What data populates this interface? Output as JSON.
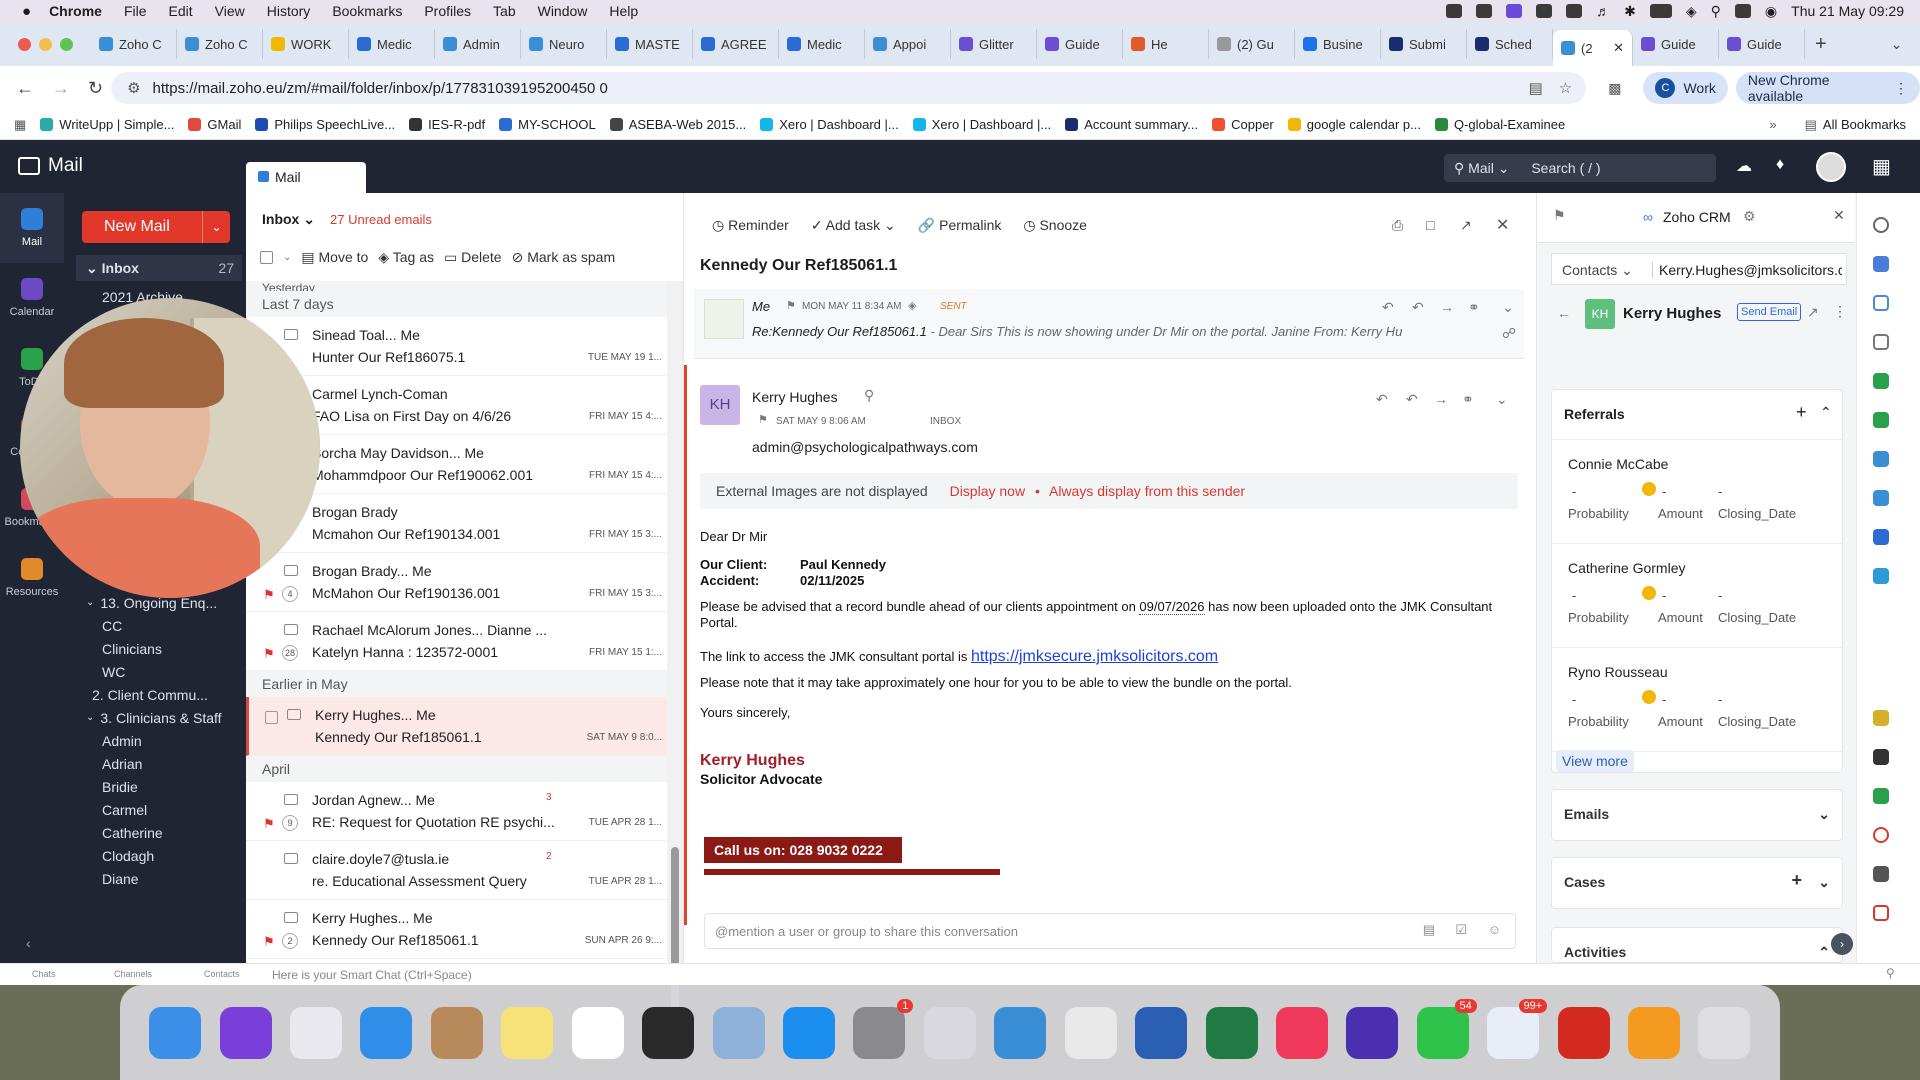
{
  "menubar": {
    "app": "Chrome",
    "items": [
      "File",
      "Edit",
      "View",
      "History",
      "Bookmarks",
      "Profiles",
      "Tab",
      "Window",
      "Help"
    ],
    "clock": "Thu 21 May  09:29"
  },
  "tabs": [
    {
      "label": "Zoho C",
      "color": "#3a8ed6"
    },
    {
      "label": "Zoho C",
      "color": "#3a8ed6"
    },
    {
      "label": "WORK",
      "color": "#f2b705"
    },
    {
      "label": "Medic",
      "color": "#2a6bd4"
    },
    {
      "label": "Admin",
      "color": "#3a8ed6"
    },
    {
      "label": "Neuro",
      "color": "#3a8ed6"
    },
    {
      "label": "MASTE",
      "color": "#2a6bd4"
    },
    {
      "label": "AGREE",
      "color": "#2a6bd4"
    },
    {
      "label": "Medic",
      "color": "#2a6bd4"
    },
    {
      "label": "Appoi",
      "color": "#3a8ed6"
    },
    {
      "label": "Glitter",
      "color": "#6b4fd3"
    },
    {
      "label": "Guide",
      "color": "#6b4fd3"
    },
    {
      "label": "He",
      "color": "#e05a2b"
    },
    {
      "label": "(2) Gu",
      "color": "#999"
    },
    {
      "label": "Busine",
      "color": "#1a73e8"
    },
    {
      "label": "Submi",
      "color": "#1a2b6e"
    },
    {
      "label": "Sched",
      "color": "#1a2b6e"
    },
    {
      "label": "(2",
      "color": "#3a8ed6",
      "active": true
    },
    {
      "label": "Guide",
      "color": "#6b4fd3"
    },
    {
      "label": "Guide",
      "color": "#6b4fd3"
    }
  ],
  "addr": {
    "url": "https://mail.zoho.eu/zm/#mail/folder/inbox/p/177831039195200450 0",
    "work": "Work",
    "update": "New Chrome available"
  },
  "bookmarks": [
    {
      "label": "WriteUpp | Simple...",
      "color": "#2aa9a9"
    },
    {
      "label": "GMail",
      "color": "#e04a3c"
    },
    {
      "label": "Philips SpeechLive...",
      "color": "#1b4db3"
    },
    {
      "label": "IES-R-pdf",
      "color": "#333"
    },
    {
      "label": "MY-SCHOOL",
      "color": "#2a6bd4"
    },
    {
      "label": "ASEBA-Web 2015...",
      "color": "#444"
    },
    {
      "label": "Xero | Dashboard |...",
      "color": "#13b5ea"
    },
    {
      "label": "Xero | Dashboard |...",
      "color": "#13b5ea"
    },
    {
      "label": "Account summary...",
      "color": "#1a2b6e"
    },
    {
      "label": "Copper",
      "color": "#f04f30"
    },
    {
      "label": "google calendar p...",
      "color": "#f2b705"
    },
    {
      "label": "Q-global-Examinee",
      "color": "#2a8a3a"
    }
  ],
  "all_bookmarks": "All Bookmarks",
  "zoho": {
    "app_title": "Mail",
    "mail_tab": "Mail",
    "search_scope": "Mail",
    "search_placeholder": "Search ( / )",
    "new_mail": "New Mail"
  },
  "leftnav": [
    {
      "label": "Mail",
      "color": "#2f7fd8"
    },
    {
      "label": "Calendar",
      "color": "#6a4bc4"
    },
    {
      "label": "ToDo",
      "color": "#2aa04a"
    },
    {
      "label": "Contacts",
      "color": "#d04a4a"
    },
    {
      "label": "Bookmarks",
      "color": "#d04a5c"
    },
    {
      "label": "Resources",
      "color": "#e08a2a"
    }
  ],
  "folders": {
    "inbox": "Inbox",
    "inbox_count": "27",
    "archive": "2021 Archive",
    "items": [
      "13. Ongoing Enq...",
      "CC",
      "Clinicians",
      "WC",
      "2. Client Commu...",
      "3. Clinicians & Staff",
      "Admin",
      "Adrian",
      "Bridie",
      "Carmel",
      "Catherine",
      "Clodagh",
      "Diane"
    ]
  },
  "list": {
    "title": "Inbox",
    "unread": "27 Unread emails",
    "actions": [
      "Move to",
      "Tag as",
      "Delete",
      "Mark as spam"
    ],
    "group_yesterday": "Yesterday",
    "group_week": "Last 7 days",
    "group_may": "Earlier in May",
    "group_april": "April",
    "rows": [
      {
        "sender": "Sinead Toal... Me",
        "subject": "Hunter Our Ref186075.1",
        "date": "TUE MAY 19 1..."
      },
      {
        "sender": "Carmel Lynch-Coman",
        "subject": "FAO Lisa on First Day on 4/6/26",
        "date": "FRI MAY 15 4:..."
      },
      {
        "sender": "Sorcha May Davidson... Me",
        "subject": "Mohammdpoor Our Ref190062.001",
        "date": "FRI MAY 15 4:..."
      },
      {
        "sender": "Brogan Brady",
        "subject": "Mcmahon Our Ref190134.001",
        "date": "FRI MAY 15 3:..."
      },
      {
        "sender": "Brogan Brady... Me",
        "subject": "McMahon Our Ref190136.001",
        "date": "FRI MAY 15 3:...",
        "count": "4",
        "flag": true
      },
      {
        "sender": "Rachael McAlorum Jones... Dianne ...",
        "subject": "Katelyn Hanna : 123572-0001",
        "date": "FRI MAY 15 1:...",
        "count": "28",
        "flag": true
      },
      {
        "sender": "Kerry Hughes... Me",
        "subject": "Kennedy Our Ref185061.1",
        "date": "SAT MAY 9 8:0..."
      },
      {
        "sender": "Jordan Agnew... Me",
        "subject": "RE: Request for Quotation RE psychi...",
        "date": "TUE APR 28 1...",
        "count": "9",
        "flag": true,
        "tag": "3"
      },
      {
        "sender": "claire.doyle7@tusla.ie",
        "subject": "re. Educational Assessment Query",
        "date": "TUE APR 28 1...",
        "tag": "2"
      },
      {
        "sender": "Kerry Hughes... Me",
        "subject": "Kennedy Our Ref185061.1",
        "date": "SUN APR 26 9:...",
        "count": "2",
        "flag": true
      }
    ]
  },
  "reading": {
    "toolbar": [
      "Reminder",
      "Add task",
      "Permalink",
      "Snooze"
    ],
    "subject": "Kennedy Our Ref185061.1",
    "thread1": {
      "from": "Me",
      "date": "MON MAY 11 8:34 AM",
      "status": "SENT",
      "preview_subject": "Re:Kennedy Our Ref185061.1",
      "preview": " - Dear Sirs This is now showing under Dr Mir on the portal. Janine From: Kerry Hughes <Kerry...."
    },
    "thread2": {
      "initials": "KH",
      "from": "Kerry Hughes",
      "date": "SAT MAY 9 8:06 AM",
      "folder": "INBOX",
      "to": "admin@psychologicalpathways.com"
    },
    "images_notice": "External Images are not displayed",
    "display_now": "Display now",
    "always_display": "Always display from this sender",
    "body": {
      "greeting": "Dear Dr Mir",
      "client_label": "Our Client:",
      "client": "Paul Kennedy",
      "accident_label": "Accident:",
      "accident": "02/11/2025",
      "p1a": "Please be advised that a record bundle ahead of our clients appointment on ",
      "p1date": "09/07/2026",
      "p1b": " has now been uploaded onto the JMK Consultant Portal.",
      "p2": "The link to access the JMK consultant portal is ",
      "link": "https://jmksecure.jmksolicitors.com",
      "p3": "Please note that it may take approximately one hour for you to be able to view the bundle on the portal.",
      "closing": "Yours sincerely,",
      "sig_name": "Kerry Hughes",
      "sig_title": "Solicitor Advocate",
      "call": "Call us on: 028 9032 0222"
    },
    "mention_placeholder": "@mention a user or group to share this conversation"
  },
  "crm": {
    "title": "Zoho CRM",
    "module": "Contacts",
    "email": "Kerry.Hughes@jmksolicitors.co",
    "contact_initials": "KH",
    "contact": "Kerry Hughes",
    "send_email": "Send Email",
    "referrals": "Referrals",
    "refs": [
      {
        "name": "Connie McCabe"
      },
      {
        "name": "Catherine Gormley"
      },
      {
        "name": "Ryno Rousseau"
      }
    ],
    "dash": "-",
    "amount_dash": "-",
    "lbl_prob": "Probability",
    "lbl_amount": "Amount",
    "lbl_close": "Closing_Date",
    "view_more": "View more",
    "emails": "Emails",
    "cases": "Cases",
    "activities": "Activities"
  },
  "footer": {
    "chats": "Chats",
    "channels": "Channels",
    "contacts": "Contacts",
    "smartchat": "Here is your Smart Chat (Ctrl+Space)"
  },
  "dock": [
    {
      "name": "finder",
      "color": "#3b8fe8"
    },
    {
      "name": "siri",
      "color": "#7a3fd8"
    },
    {
      "name": "launchpad",
      "color": "#e8e8ee"
    },
    {
      "name": "safari",
      "color": "#2f8fe8"
    },
    {
      "name": "contacts",
      "color": "#b8895a"
    },
    {
      "name": "notes",
      "color": "#f7e27a"
    },
    {
      "name": "freeform",
      "color": "#ffffff"
    },
    {
      "name": "app-dark",
      "color": "#2a2a2a"
    },
    {
      "name": "preview",
      "color": "#8fb0d8"
    },
    {
      "name": "app-store",
      "color": "#1b8ef0"
    },
    {
      "name": "system-settings",
      "color": "#8a8a8e",
      "badge": "1"
    },
    {
      "name": "iphone-mirroring",
      "color": "#d8d8de"
    },
    {
      "name": "zoho-workdrive",
      "color": "#3a8ed6"
    },
    {
      "name": "chrome",
      "color": "#e8e8e8"
    },
    {
      "name": "word",
      "color": "#2b5fb3"
    },
    {
      "name": "excel",
      "color": "#1f7a44"
    },
    {
      "name": "music",
      "color": "#f0395a"
    },
    {
      "name": "glitter",
      "color": "#4a2fb0"
    },
    {
      "name": "facetime",
      "color": "#2fc24a",
      "badge": "54"
    },
    {
      "name": "mail",
      "color": "#e8eef7",
      "badge": "99+"
    },
    {
      "name": "acrobat",
      "color": "#d32a1f"
    },
    {
      "name": "pages",
      "color": "#f39a1f"
    },
    {
      "name": "trash",
      "color": "#dedee2"
    }
  ]
}
